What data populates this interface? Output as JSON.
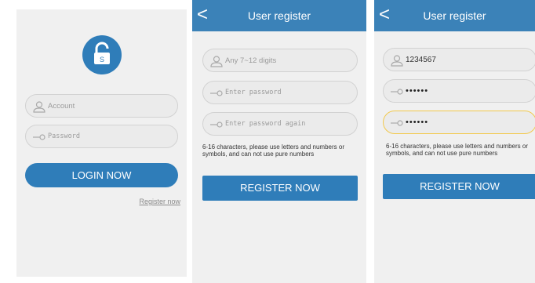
{
  "login": {
    "lock_letter": "S",
    "account_placeholder": "Account",
    "password_placeholder": "Password",
    "login_button": "LOGIN NOW",
    "register_link": "Register now"
  },
  "register_empty": {
    "nav_back": "<",
    "title": "User register",
    "account_placeholder": "Any 7~12 digits",
    "password_placeholder": "Enter password",
    "password_again_placeholder": "Enter password again",
    "hint": "6-16 characters, please use letters and numbers or symbols, and can not use pure numbers",
    "register_button": "REGISTER NOW"
  },
  "register_filled": {
    "nav_back": "<",
    "title": "User register",
    "account_value": "1234567",
    "password_value": "••••••",
    "password_again_value": "••••••",
    "hint": "6-16 characters, please use letters and numbers or symbols, and can not use pure numbers",
    "register_button": "REGISTER NOW"
  },
  "colors": {
    "primary": "#2f7db9",
    "nav": "#3b82b8",
    "focus_border": "#f2c94c",
    "screen_bg": "#f0f0f0"
  },
  "icons": {
    "user": "user-icon",
    "key": "key-icon",
    "lock": "lock-icon",
    "back": "chevron-left-icon"
  }
}
